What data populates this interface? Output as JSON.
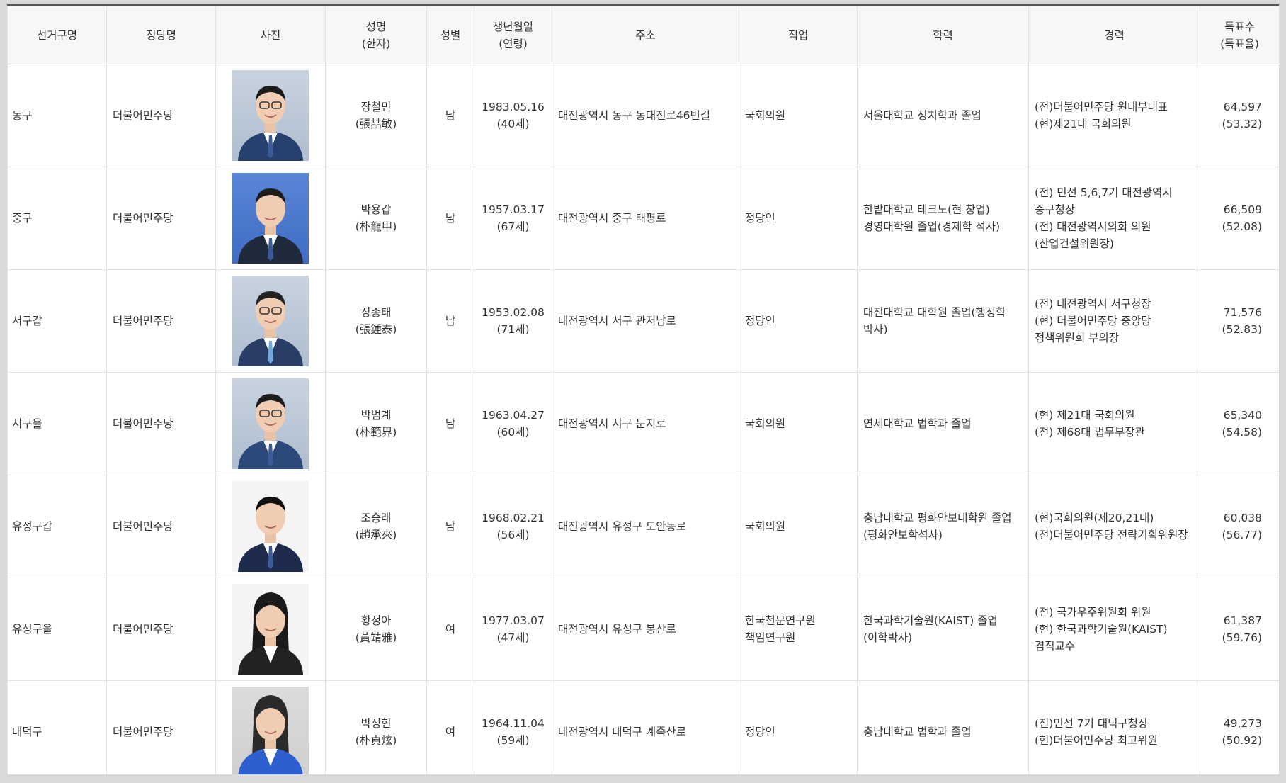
{
  "headers": {
    "district": "선거구명",
    "party": "정당명",
    "photo": "사진",
    "name_line1": "성명",
    "name_line2": "(한자)",
    "gender": "성별",
    "birth_line1": "생년월일",
    "birth_line2": "(연령)",
    "address": "주소",
    "job": "직업",
    "education": "학력",
    "career": "경력",
    "votes_line1": "득표수",
    "votes_line2": "(득표율)"
  },
  "rows": [
    {
      "district": "동구",
      "party": "더불어민주당",
      "name": "장철민",
      "hanja": "(張喆敏)",
      "gender": "남",
      "birth": "1983.05.16",
      "age": "(40세)",
      "address": "대전광역시 동구 동대전로46번길",
      "job": [
        "국회의원"
      ],
      "education": [
        "서울대학교 정치학과 졸업"
      ],
      "career": [
        "(전)더불어민주당 원내부대표",
        "(현)제21대 국회의원"
      ],
      "votes": "64,597",
      "rate": "(53.32)"
    },
    {
      "district": "중구",
      "party": "더불어민주당",
      "name": "박용갑",
      "hanja": "(朴龍甲)",
      "gender": "남",
      "birth": "1957.03.17",
      "age": "(67세)",
      "address": "대전광역시 중구 태평로",
      "job": [
        "정당인"
      ],
      "education": [
        "한밭대학교 테크노(현 창업)",
        "경영대학원 졸업(경제학 석사)"
      ],
      "career": [
        "(전) 민선 5,6,7기 대전광역시",
        "중구청장",
        "(전) 대전광역시의회 의원",
        "(산업건설위원장)"
      ],
      "votes": "66,509",
      "rate": "(52.08)"
    },
    {
      "district": "서구갑",
      "party": "더불어민주당",
      "name": "장종태",
      "hanja": "(張鍾泰)",
      "gender": "남",
      "birth": "1953.02.08",
      "age": "(71세)",
      "address": "대전광역시 서구 관저남로",
      "job": [
        "정당인"
      ],
      "education": [
        "대전대학교 대학원 졸업(행정학",
        "박사)"
      ],
      "career": [
        "(전) 대전광역시 서구청장",
        "(현) 더불어민주당 중앙당",
        "정책위원회 부의장"
      ],
      "votes": "71,576",
      "rate": "(52.83)"
    },
    {
      "district": "서구을",
      "party": "더불어민주당",
      "name": "박범계",
      "hanja": "(朴範界)",
      "gender": "남",
      "birth": "1963.04.27",
      "age": "(60세)",
      "address": "대전광역시 서구 둔지로",
      "job": [
        "국회의원"
      ],
      "education": [
        "연세대학교 법학과 졸업"
      ],
      "career": [
        "(현) 제21대 국회의원",
        "(전) 제68대 법무부장관"
      ],
      "votes": "65,340",
      "rate": "(54.58)"
    },
    {
      "district": "유성구갑",
      "party": "더불어민주당",
      "name": "조승래",
      "hanja": "(趙承來)",
      "gender": "남",
      "birth": "1968.02.21",
      "age": "(56세)",
      "address": "대전광역시 유성구 도안동로",
      "job": [
        "국회의원"
      ],
      "education": [
        "충남대학교 평화안보대학원 졸업",
        "(평화안보학석사)"
      ],
      "career": [
        "(현)국회의원(제20,21대)",
        "(전)더불어민주당 전략기획위원장"
      ],
      "votes": "60,038",
      "rate": "(56.77)"
    },
    {
      "district": "유성구을",
      "party": "더불어민주당",
      "name": "황정아",
      "hanja": "(黃靖雅)",
      "gender": "여",
      "birth": "1977.03.07",
      "age": "(47세)",
      "address": "대전광역시 유성구 봉산로",
      "job": [
        "한국천문연구원",
        "책임연구원"
      ],
      "education": [
        "한국과학기술원(KAIST) 졸업",
        "(이학박사)"
      ],
      "career": [
        "(전) 국가우주위원회 위원",
        "(현) 한국과학기술원(KAIST)",
        "겸직교수"
      ],
      "votes": "61,387",
      "rate": "(59.76)"
    },
    {
      "district": "대덕구",
      "party": "더불어민주당",
      "name": "박정현",
      "hanja": "(朴貞炫)",
      "gender": "여",
      "birth": "1964.11.04",
      "age": "(59세)",
      "address": "대전광역시 대덕구 계족산로",
      "job": [
        "정당인"
      ],
      "education": [
        "충남대학교 법학과 졸업"
      ],
      "career": [
        "(전)민선 7기 대덕구청장",
        "(현)더불어민주당 최고위원"
      ],
      "votes": "49,273",
      "rate": "(50.92)"
    }
  ]
}
